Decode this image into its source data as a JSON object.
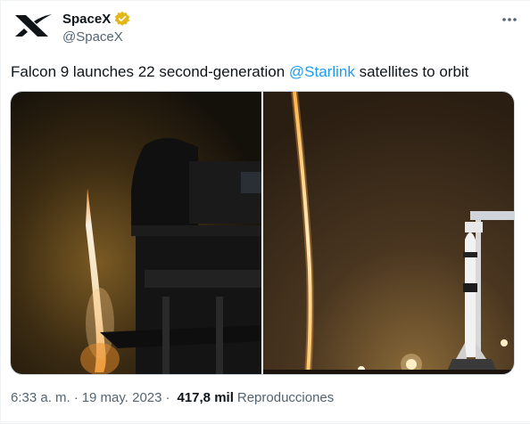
{
  "author": {
    "display_name": "SpaceX",
    "handle": "@SpaceX",
    "verified_badge_color": "#e2b719",
    "avatar_icon": "spacex-x-logo-icon"
  },
  "tweet": {
    "text_before": "Falcon 9 launches 22 second-generation ",
    "mention": "@Starlink",
    "text_after": " satellites to orbit"
  },
  "media": {
    "left_photo": "rocket-launch-exhaust-trail-photo",
    "right_photo": "long-exposure-launch-streak-photo"
  },
  "meta": {
    "time": "6:33 a. m.",
    "separator": "·",
    "date": "19 may. 2023",
    "views_count": "417,8 mil",
    "views_label": "Reproducciones"
  },
  "colors": {
    "link": "#1d9bf0",
    "secondary_text": "#536471",
    "primary_text": "#0f1419"
  }
}
